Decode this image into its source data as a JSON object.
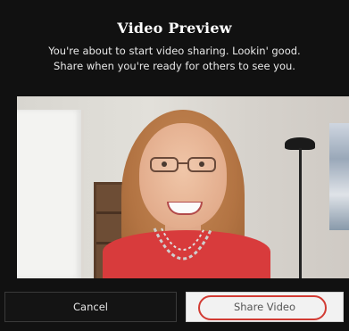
{
  "dialog": {
    "title": "Video Preview",
    "description_line1": "You're about to start video sharing. Lookin' good.",
    "description_line2": "Share when you're ready for others to see you."
  },
  "buttons": {
    "cancel_label": "Cancel",
    "share_label": "Share Video"
  },
  "colors": {
    "background": "#111111",
    "highlight": "#d23b33",
    "share_button": "#f2f2f2"
  }
}
